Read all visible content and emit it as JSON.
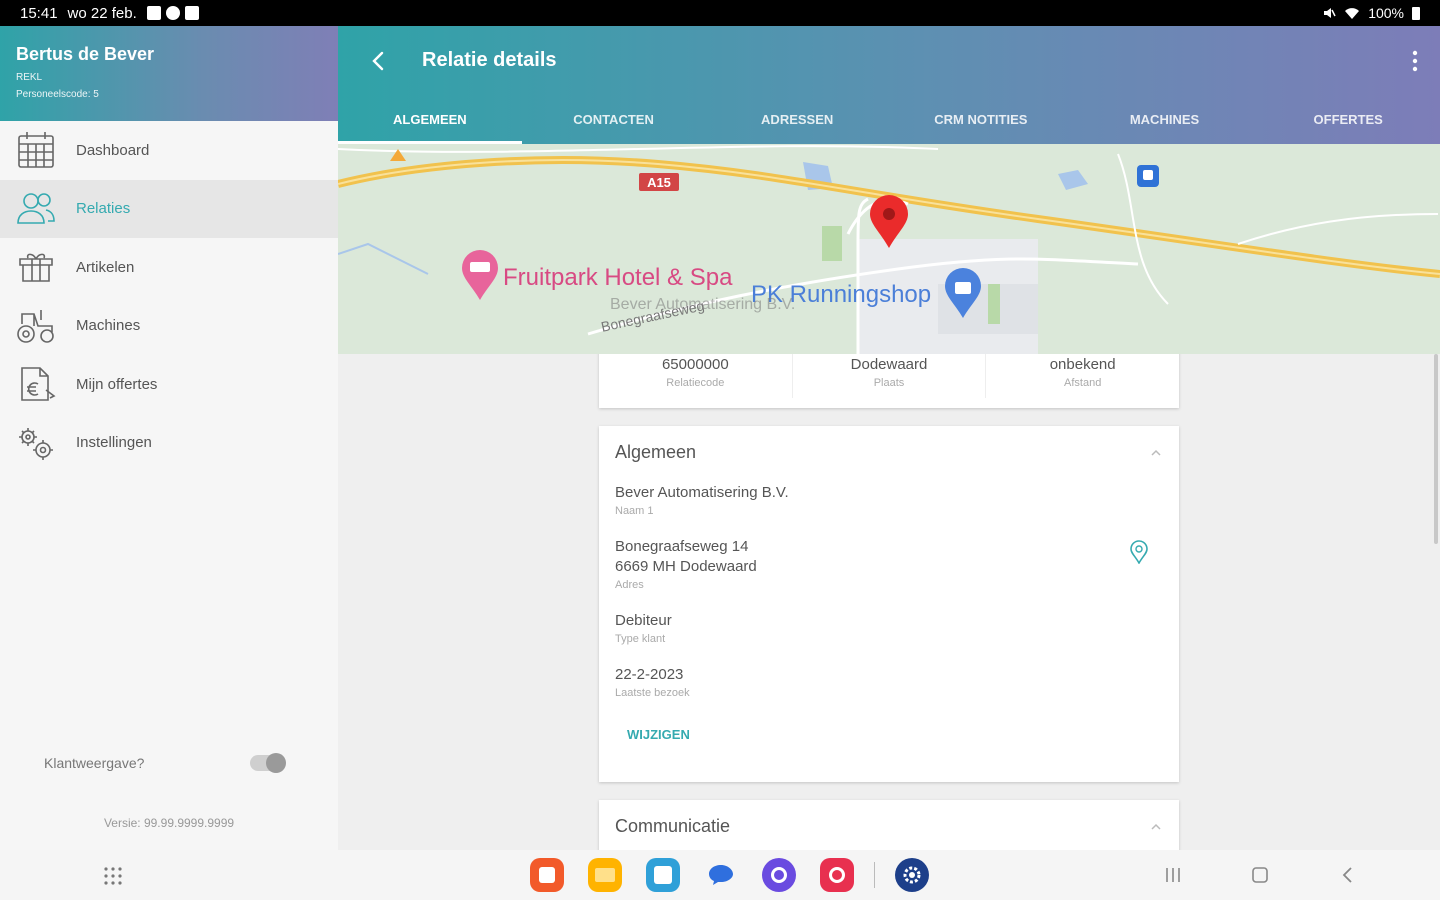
{
  "status": {
    "time": "15:41",
    "date": "wo 22 feb.",
    "battery": "100%"
  },
  "sidebar": {
    "user_name": "Bertus de Bever",
    "user_role": "REKL",
    "user_code": "Personeelscode: 5",
    "items": [
      {
        "label": "Dashboard",
        "icon": "calendar-icon",
        "active": false
      },
      {
        "label": "Relaties",
        "icon": "users-icon",
        "active": true
      },
      {
        "label": "Artikelen",
        "icon": "box-icon",
        "active": false
      },
      {
        "label": "Machines",
        "icon": "tractor-icon",
        "active": false
      },
      {
        "label": "Mijn offertes",
        "icon": "document-euro-icon",
        "active": false
      },
      {
        "label": "Instellingen",
        "icon": "gears-icon",
        "active": false
      }
    ],
    "toggle_label": "Klantweergave?",
    "version": "Versie: 99.99.9999.9999"
  },
  "appbar": {
    "title": "Relatie details",
    "tabs": [
      "ALGEMEEN",
      "CONTACTEN",
      "ADRESSEN",
      "CRM NOTITIES",
      "MACHINES",
      "OFFERTES"
    ],
    "active_tab": 0
  },
  "map": {
    "road_label": "A15",
    "poi_hotel": "Fruitpark Hotel & Spa",
    "poi_shop": "PK Runningshop",
    "street": "Bonegraafseweg",
    "company_overlay": "Bever Automatisering B.V."
  },
  "summary": [
    {
      "value": "65000000",
      "label": "Relatiecode"
    },
    {
      "value": "Dodewaard",
      "label": "Plaats"
    },
    {
      "value": "onbekend",
      "label": "Afstand"
    }
  ],
  "general": {
    "heading": "Algemeen",
    "name_value": "Bever Automatisering B.V.",
    "name_label": "Naam 1",
    "address_line1": "Bonegraafseweg 14",
    "address_line2": "6669 MH Dodewaard",
    "address_label": "Adres",
    "type_value": "Debiteur",
    "type_label": "Type klant",
    "visit_value": "22-2-2023",
    "visit_label": "Laatste bezoek",
    "edit_label": "WIJZIGEN"
  },
  "communication": {
    "heading": "Communicatie"
  },
  "colors": {
    "accent": "#35aab0",
    "header_start": "#2fa3a8",
    "header_end": "#7d7db8"
  }
}
